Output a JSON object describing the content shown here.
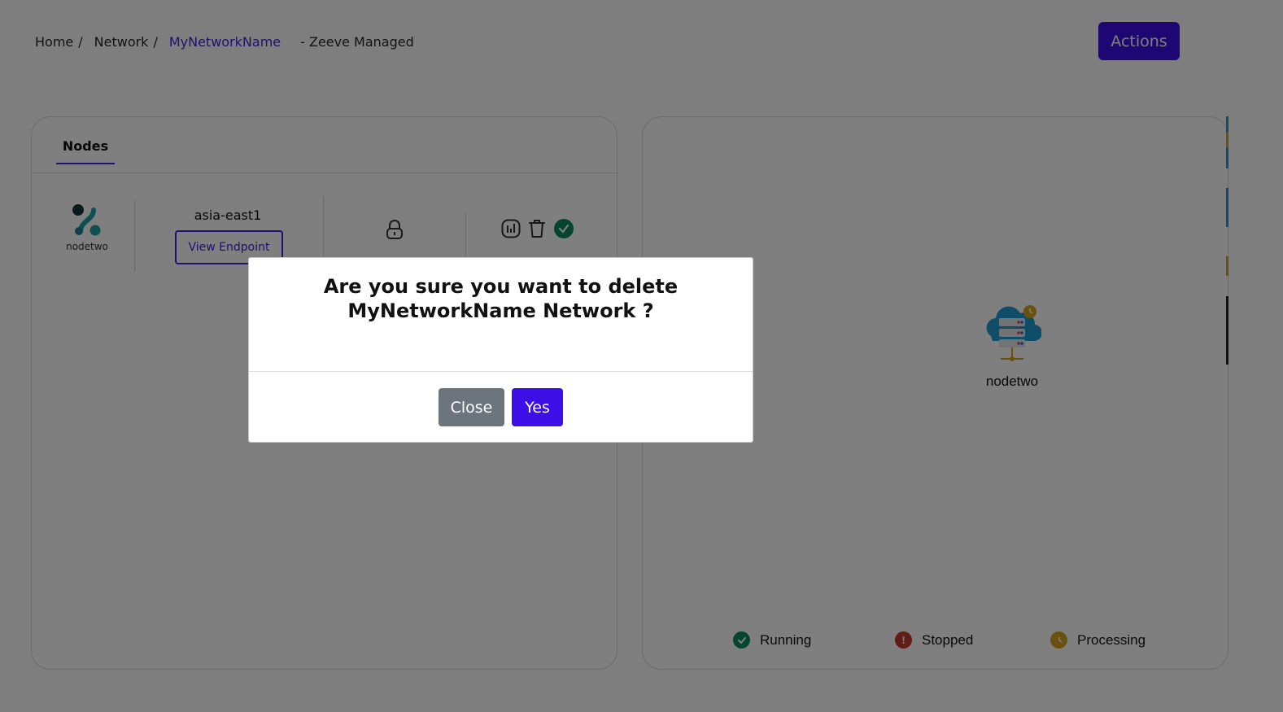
{
  "breadcrumb": {
    "home": "Home",
    "network": "Network",
    "current": "MyNetworkName",
    "subtitle": "- Zeeve Managed",
    "separator": "/"
  },
  "header": {
    "actions_label": "Actions"
  },
  "nodes_panel": {
    "tab_label": "Nodes",
    "rows": [
      {
        "name": "nodetwo",
        "region": "asia-east1",
        "endpoint_label": "View Endpoint",
        "status": "Running"
      }
    ]
  },
  "diagram": {
    "node_label": "nodetwo",
    "legend": [
      {
        "label": "Running",
        "color": "#0a8a5f"
      },
      {
        "label": "Stopped",
        "color": "#c0392b"
      },
      {
        "label": "Processing",
        "color": "#d4a21a"
      }
    ]
  },
  "modal": {
    "title": "Are you sure you want to delete MyNetworkName Network ?",
    "close_label": "Close",
    "yes_label": "Yes"
  },
  "colors": {
    "primary": "#3d0fe6",
    "secondary": "#6c757d",
    "success": "#0a8a5f",
    "danger": "#c0392b",
    "warning": "#d4a21a"
  },
  "icons": [
    "network-logo-icon",
    "lock-icon",
    "chart-icon",
    "trash-icon",
    "check-circle-icon",
    "cloud-server-icon"
  ]
}
